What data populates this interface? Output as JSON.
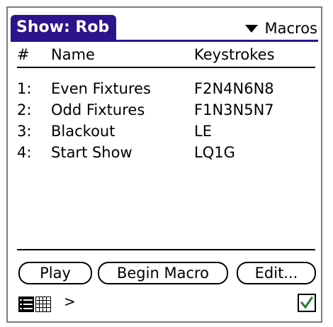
{
  "header": {
    "title": "Show: Rob",
    "menu_label": "Macros"
  },
  "table": {
    "columns": [
      "#",
      "Name",
      "Keystrokes"
    ],
    "rows": [
      {
        "num": "1:",
        "name": "Even Fixtures",
        "keys": "F2N4N6N8"
      },
      {
        "num": "2:",
        "name": "Odd Fixtures",
        "keys": "F1N3N5N7"
      },
      {
        "num": "3:",
        "name": "Blackout",
        "keys": "LE"
      },
      {
        "num": "4:",
        "name": "Start Show",
        "keys": "LQ1G"
      }
    ]
  },
  "buttons": {
    "play": "Play",
    "begin_macro": "Begin Macro",
    "edit": "Edit..."
  },
  "footer": {
    "chevron": ">",
    "checkbox_checked": true,
    "icons": [
      "list-view-icon",
      "grid-view-icon",
      "checkmark-icon"
    ]
  },
  "colors": {
    "title_bar": "#2d138c",
    "checkmark": "#2e7d2e"
  }
}
